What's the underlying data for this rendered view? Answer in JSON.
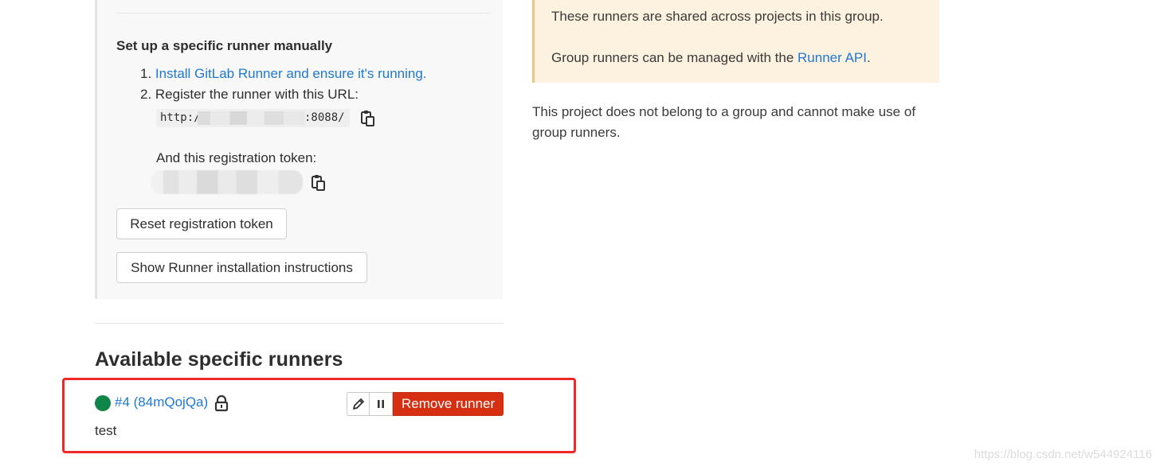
{
  "setup": {
    "title": "Set up a specific runner manually",
    "step1_number": "1.",
    "step1_link": "Install GitLab Runner and ensure it's running.",
    "step2_text": "2. Register the runner with this URL:",
    "url_prefix": "http:/",
    "url_suffix": ":8088/",
    "token_label": "And this registration token:",
    "reset_button": "Reset registration token",
    "show_instructions_button": "Show Runner installation instructions"
  },
  "shared_runners": {
    "line1": "These runners are shared across projects in this group.",
    "line2_prefix": "Group runners can be managed with the ",
    "line2_link": "Runner API",
    "line2_suffix": ".",
    "no_group_text": "This project does not belong to a group and cannot make use of group runners."
  },
  "available": {
    "title": "Available specific runners",
    "runner": {
      "id_label": "#4 (84mQojQa)",
      "description": "test",
      "status_color": "#108548",
      "remove_button": "Remove runner"
    }
  },
  "watermark": "https://blog.csdn.net/w544924116",
  "colors": {
    "link": "#1f78d1",
    "danger": "#d62f12",
    "highlight_border": "#ef2727",
    "info_bg": "#fdf1df"
  },
  "icons": {
    "copy": "clipboard-icon",
    "lock": "lock-icon",
    "edit": "pencil-icon",
    "pause": "pause-icon"
  }
}
